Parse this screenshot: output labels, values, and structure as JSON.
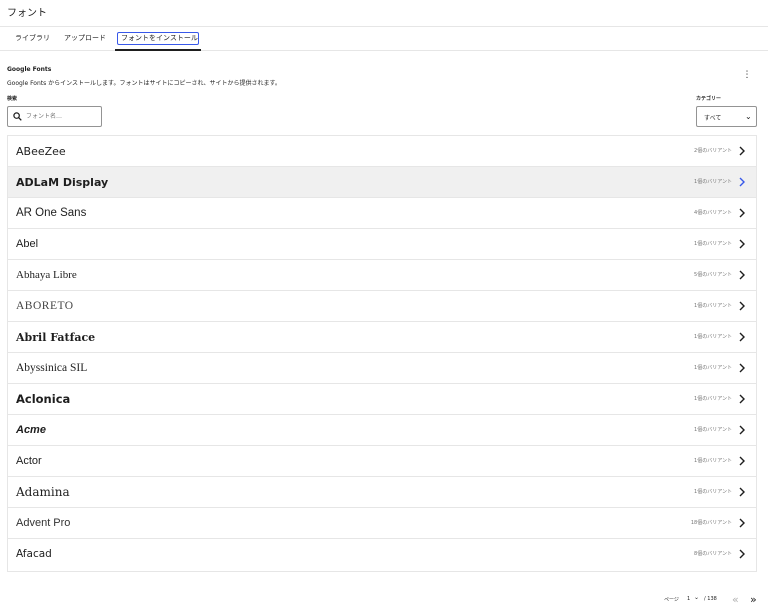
{
  "header": {
    "title": "フォント"
  },
  "tabs": [
    {
      "label": "ライブラリ"
    },
    {
      "label": "アップロード"
    },
    {
      "label": "フォントをインストール"
    }
  ],
  "section": {
    "title": "Google Fonts",
    "description": "Google Fonts からインストールします。フォントはサイトにコピーされ、サイトから提供されます。"
  },
  "search": {
    "label": "検索",
    "placeholder": "フォント名…"
  },
  "category": {
    "label": "カテゴリー",
    "value": "すべて"
  },
  "fonts": [
    {
      "name": "ABeeZee",
      "variants": "2個のバリアント"
    },
    {
      "name": "ADLaM Display",
      "variants": "1個のバリアント"
    },
    {
      "name": "AR One Sans",
      "variants": "4個のバリアント"
    },
    {
      "name": "Abel",
      "variants": "1個のバリアント"
    },
    {
      "name": "Abhaya Libre",
      "variants": "5個のバリアント"
    },
    {
      "name": "ABORETO",
      "variants": "1個のバリアント"
    },
    {
      "name": "Abril Fatface",
      "variants": "1個のバリアント"
    },
    {
      "name": "Abyssinica SIL",
      "variants": "1個のバリアント"
    },
    {
      "name": "Aclonica",
      "variants": "1個のバリアント"
    },
    {
      "name": "Acme",
      "variants": "1個のバリアント"
    },
    {
      "name": "Actor",
      "variants": "1個のバリアント"
    },
    {
      "name": "Adamina",
      "variants": "1個のバリアント"
    },
    {
      "name": "Advent Pro",
      "variants": "18個のバリアント"
    },
    {
      "name": "Afacad",
      "variants": "8個のバリアント"
    }
  ],
  "pagination": {
    "label": "ページ",
    "current": "1",
    "total": "/ 138",
    "prev": "«",
    "next": "»",
    "dropdown": "⌄"
  },
  "colors": {
    "accent": "#3858e9",
    "text": "#1e1e1e",
    "muted": "#757575",
    "border": "#e6e6e6",
    "hover_row": "#f0f0f0"
  }
}
